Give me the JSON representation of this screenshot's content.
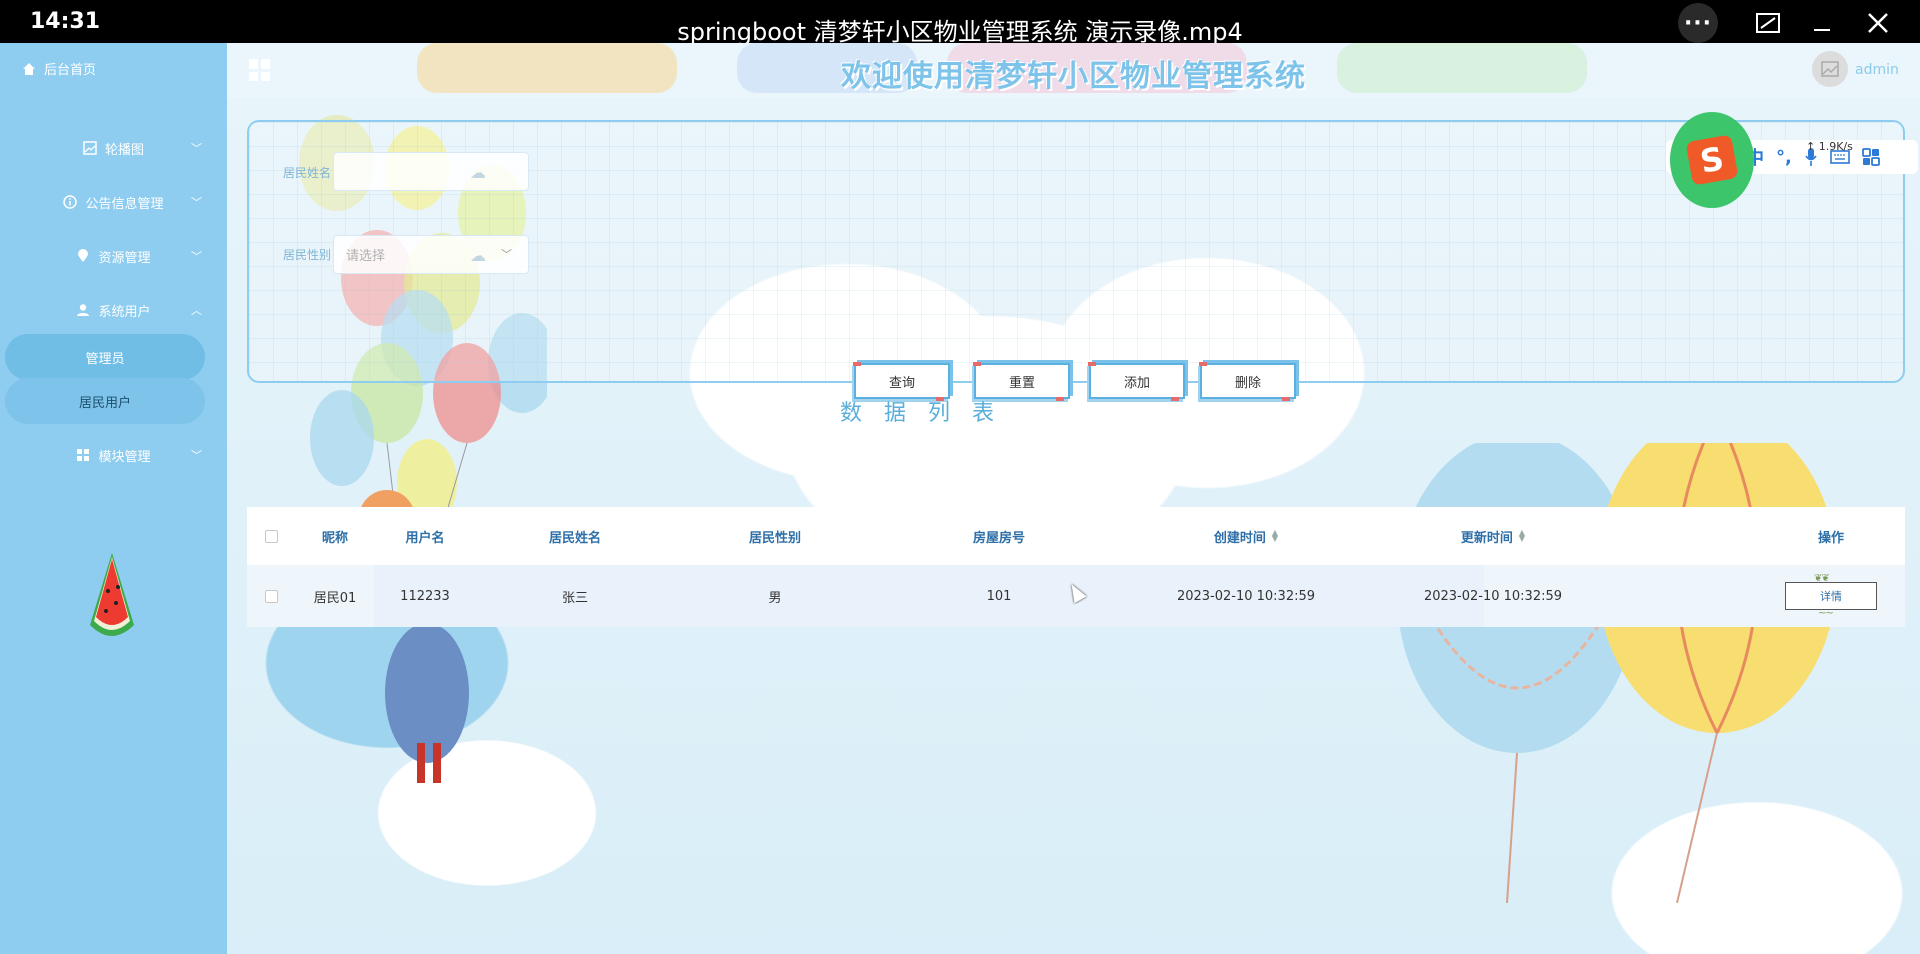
{
  "player": {
    "clock": "14:31",
    "title": "springboot 清梦轩小区物业管理系统 演示录像.mp4",
    "more": "···",
    "pip": "⧉",
    "minimize": "—",
    "close": "✕"
  },
  "sidebar": {
    "home": "后台首页",
    "items": [
      {
        "label": "轮播图",
        "icon": "image-icon"
      },
      {
        "label": "公告信息管理",
        "icon": "info-icon"
      },
      {
        "label": "资源管理",
        "icon": "pin-icon"
      },
      {
        "label": "系统用户",
        "icon": "user-icon"
      },
      {
        "label": "模块管理",
        "icon": "grid-icon"
      }
    ],
    "sub_items": [
      "管理员",
      "居民用户"
    ]
  },
  "header": {
    "title": "欢迎使用清梦轩小区物业管理系统",
    "user": "admin"
  },
  "search": {
    "name_label": "居民姓名",
    "name_value": "",
    "gender_label": "居民性别",
    "gender_placeholder": "请选择",
    "buttons": {
      "query": "查询",
      "reset": "重置",
      "add": "添加",
      "delete": "删除"
    }
  },
  "list_title": "数据列表",
  "table": {
    "headers": {
      "nickname": "昵称",
      "username": "用户名",
      "resident_name": "居民姓名",
      "gender": "居民性别",
      "room": "房屋房号",
      "created": "创建时间",
      "updated": "更新时间",
      "action": "操作"
    },
    "rows": [
      {
        "nickname": "居民01",
        "username": "112233",
        "resident_name": "张三",
        "gender": "男",
        "room": "101",
        "created": "2023-02-10 10:32:59",
        "updated": "2023-02-10 10:32:59",
        "action": "详情"
      }
    ]
  },
  "ime": {
    "speed": "1.9K/s",
    "mode": "中",
    "punct": "°,"
  },
  "colors": {
    "sidebar": "#8ecdf0",
    "title": "#7dc3ea",
    "header_text": "#2e6fa8",
    "accent_red": "#e86b6b"
  }
}
